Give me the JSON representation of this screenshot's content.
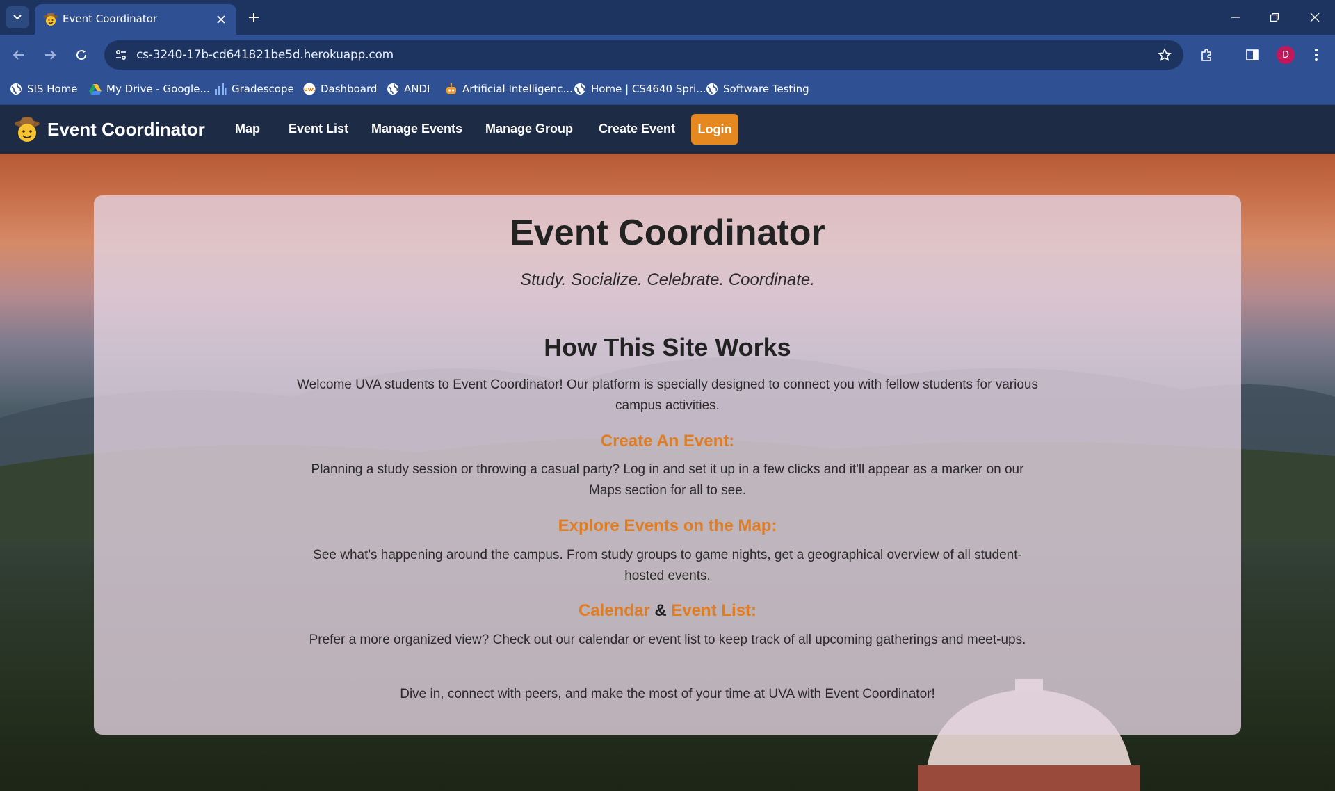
{
  "browser": {
    "tab_title": "Event Coordinator",
    "url": "cs-3240-17b-cd641821be5d.herokuapp.com",
    "profile_initial": "D",
    "bookmarks": [
      {
        "label": "SIS Home",
        "icon": "globe-icon"
      },
      {
        "label": "My Drive - Google...",
        "icon": "google-drive-icon"
      },
      {
        "label": "Gradescope",
        "icon": "bar-chart-icon"
      },
      {
        "label": "Dashboard",
        "icon": "uva-icon"
      },
      {
        "label": "ANDI",
        "icon": "globe-icon"
      },
      {
        "label": "Artificial Intelligenc...",
        "icon": "robot-icon"
      },
      {
        "label": "Home | CS4640 Spri...",
        "icon": "globe-icon"
      },
      {
        "label": "Software Testing",
        "icon": "globe-icon"
      }
    ]
  },
  "navbar": {
    "brand": "Event Coordinator",
    "links": [
      "Map",
      "Event List",
      "Manage Events",
      "Manage Group",
      "Create Event"
    ],
    "login": "Login"
  },
  "content": {
    "title": "Event Coordinator",
    "tagline": "Study. Socialize. Celebrate. Coordinate.",
    "how_heading": "How This Site Works",
    "intro_text": "Welcome UVA students to Event Coordinator! Our platform is specially designed to connect you with fellow students for various campus activities.",
    "create_heading": "Create An Event:",
    "create_text": "Planning a study session or throwing a casual party? Log in and set it up in a few clicks and it'll appear as a marker on our Maps section for all to see.",
    "explore_heading": "Explore Events on the Map:",
    "explore_text": "See what's happening around the campus. From study groups to game nights, get a geographical overview of all student-hosted events.",
    "calendar_heading_a": "Calendar",
    "calendar_heading_amp": "&",
    "calendar_heading_b": "Event List:",
    "calendar_text": "Prefer a more organized view? Check out our calendar or event list to keep track of all upcoming gatherings and meet-ups.",
    "closing_text": "Dive in, connect with peers, and make the most of your time at UVA with Event Coordinator!"
  },
  "colors": {
    "accent": "#e07d23",
    "navbar": "#1e2b45",
    "login_button": "#e58820"
  }
}
